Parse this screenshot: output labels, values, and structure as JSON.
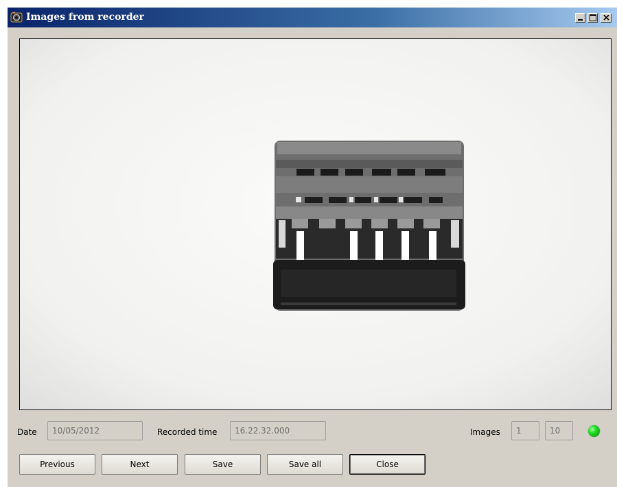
{
  "window": {
    "title": "Images from recorder"
  },
  "titlebar_buttons": {
    "minimize": "minimize",
    "maximize": "maximize",
    "close": "close"
  },
  "image_view": {
    "description_icon": "connector-photo"
  },
  "info": {
    "date_label": "Date",
    "date_value": "10/05/2012",
    "recorded_time_label": "Recorded time",
    "recorded_time_value": "16.22.32.000",
    "images_label": "Images",
    "images_current": "1",
    "images_total": "10",
    "status_color": "#22dd22"
  },
  "buttons": {
    "previous": "Previous",
    "next": "Next",
    "save": "Save",
    "save_all": "Save all",
    "close": "Close"
  }
}
